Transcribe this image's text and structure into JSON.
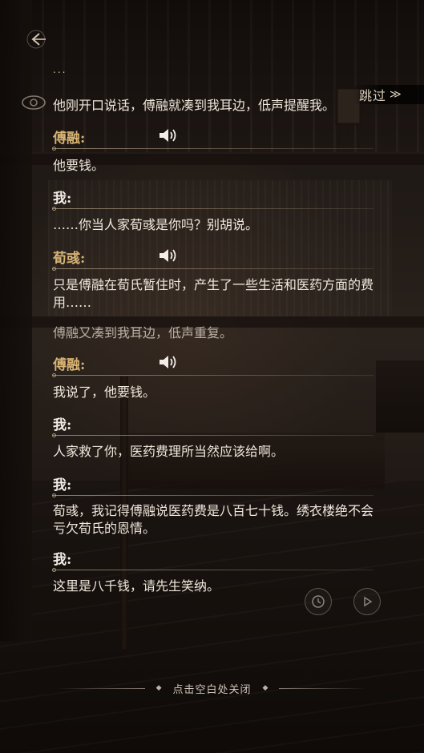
{
  "hud": {
    "skip_label": "跳过",
    "skip_chevron": "≫"
  },
  "log": {
    "ellipsis": "...",
    "entries": [
      {
        "type": "narration",
        "text": "他刚开口说话，傅融就凑到我耳边，低声提醒我。"
      },
      {
        "type": "dialogue",
        "speaker": "傅融:",
        "voice": true,
        "text": "他要钱。"
      },
      {
        "type": "dialogue",
        "speaker": "我:",
        "voice": false,
        "text": "……你当人家荀彧是你吗？别胡说。"
      },
      {
        "type": "dialogue",
        "speaker": "荀彧:",
        "voice": true,
        "text": "只是傅融在荀氏暂住时，产生了一些生活和医药方面的费用……"
      },
      {
        "type": "narration",
        "text": "傅融又凑到我耳边，低声重复。"
      },
      {
        "type": "dialogue",
        "speaker": "傅融:",
        "voice": true,
        "text": "我说了，他要钱。"
      },
      {
        "type": "dialogue",
        "speaker": "我:",
        "voice": false,
        "text": "人家救了你，医药费理所当然应该给啊。"
      },
      {
        "type": "dialogue",
        "speaker": "我:",
        "voice": false,
        "text": "荀彧，我记得傅融说医药费是八百七十钱。绣衣楼绝不会亏欠荀氏的恩情。"
      },
      {
        "type": "dialogue",
        "speaker": "我:",
        "voice": false,
        "text": "这里是八千钱，请先生笑纳。"
      }
    ]
  },
  "footer": {
    "close_hint": "点击空白处关闭"
  },
  "colors": {
    "speaker_gold": "#d7b374",
    "text_light": "#f0e8dc"
  },
  "icons": [
    "back-arrow-icon",
    "eye-icon",
    "speaker-voice-icon",
    "history-icon",
    "play-icon"
  ]
}
